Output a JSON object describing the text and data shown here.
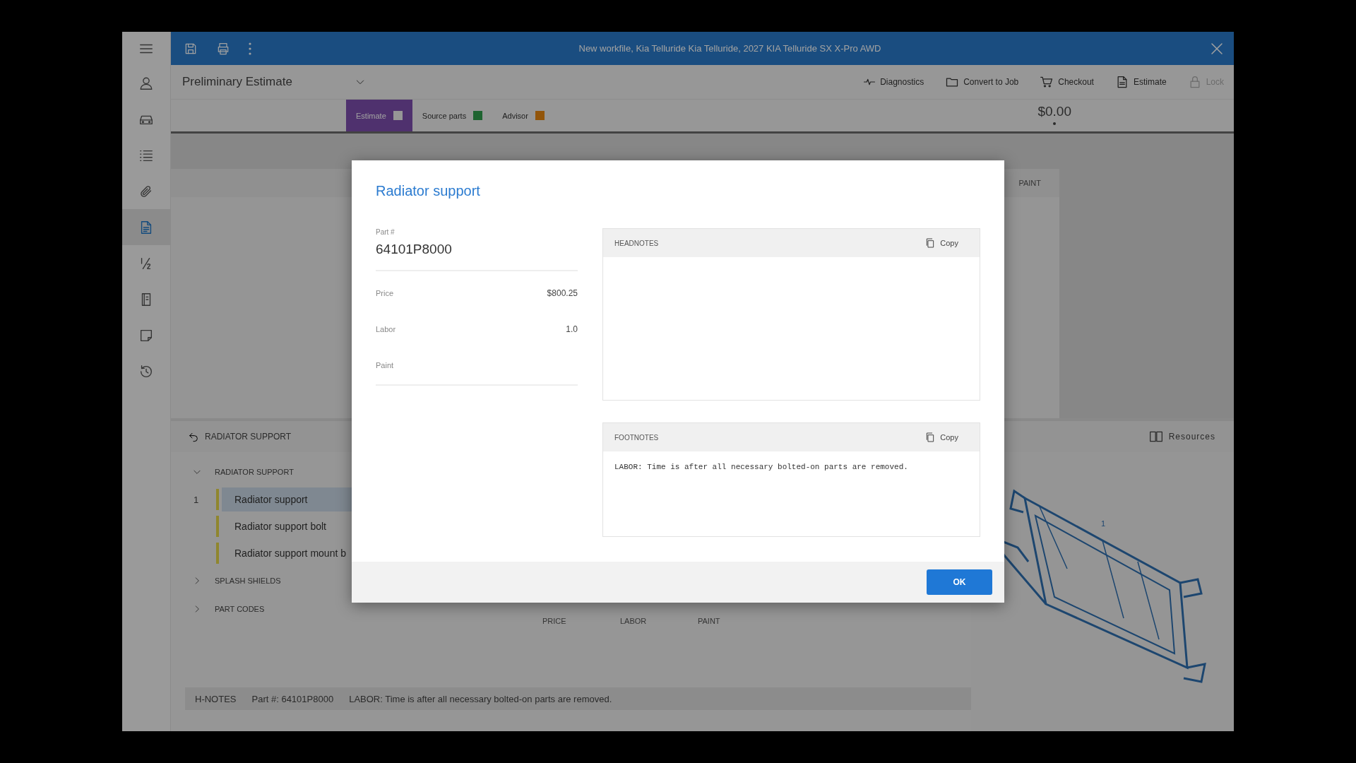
{
  "title_bar": {
    "title": "New workfile, Kia Telluride Kia Telluride, 2027 KIA Telluride SX X-Pro AWD"
  },
  "sidebar": {
    "items": [
      {
        "kind": "person",
        "selected": false
      },
      {
        "kind": "car",
        "selected": false
      },
      {
        "kind": "list",
        "selected": false
      },
      {
        "kind": "clip",
        "selected": false
      },
      {
        "kind": "estimate",
        "selected": true
      },
      {
        "kind": "fraction",
        "selected": false
      },
      {
        "kind": "book",
        "selected": false
      },
      {
        "kind": "note",
        "selected": false
      },
      {
        "kind": "history",
        "selected": false
      }
    ]
  },
  "toolbar": {
    "view": "Preliminary Estimate",
    "actions": [
      {
        "label": "Diagnostics",
        "kind": "pulse",
        "disabled": false
      },
      {
        "label": "Convert to Job",
        "kind": "folder",
        "disabled": false
      },
      {
        "label": "Checkout",
        "kind": "cart",
        "disabled": false
      },
      {
        "label": "Estimate",
        "kind": "estimate",
        "disabled": false
      },
      {
        "label": "Lock",
        "kind": "lock",
        "disabled": true
      }
    ]
  },
  "tabs": [
    {
      "label": "Estimate",
      "selected": true,
      "color": "#969696"
    },
    {
      "label": "Source parts",
      "selected": false,
      "color": "#1e6430"
    },
    {
      "label": "Advisor",
      "selected": false,
      "color": "#92550a"
    }
  ],
  "total": "$0.00",
  "grid": {
    "columns": [
      "PAINT"
    ]
  },
  "lower_panel": {
    "title": "RADIATOR SUPPORT",
    "resources": "Resources",
    "groups": [
      {
        "label": "RADIATOR SUPPORT",
        "expanded": true,
        "children": [
          {
            "number": "1",
            "label": "Radiator support",
            "selected": true
          },
          {
            "label": "Radiator support bolt",
            "selected": false
          },
          {
            "label": "Radiator support mount b",
            "selected": false
          }
        ]
      },
      {
        "label": "SPLASH SHIELDS",
        "expanded": false
      },
      {
        "label": "PART CODES",
        "expanded": false
      }
    ],
    "columns": [
      "PRICE",
      "LABOR",
      "PAINT"
    ],
    "callout": "1"
  },
  "notes_bar": {
    "label": "H-NOTES",
    "part": "Part #: 64101P8000",
    "text": "LABOR: Time is after all necessary bolted-on parts are removed."
  },
  "dialog": {
    "title": "Radiator support",
    "part_label": "Part #",
    "part_number": "64101P8000",
    "fields": [
      {
        "label": "Price",
        "value": "$800.25"
      },
      {
        "label": "Labor",
        "value": "1.0"
      },
      {
        "label": "Paint"
      }
    ],
    "notes": [
      {
        "title": "HEADNOTES",
        "copy": "Copy"
      },
      {
        "title": "FOOTNOTES",
        "copy": "Copy",
        "text": "LABOR: Time is after all necessary bolted-on parts are removed."
      }
    ],
    "ok": "OK"
  }
}
